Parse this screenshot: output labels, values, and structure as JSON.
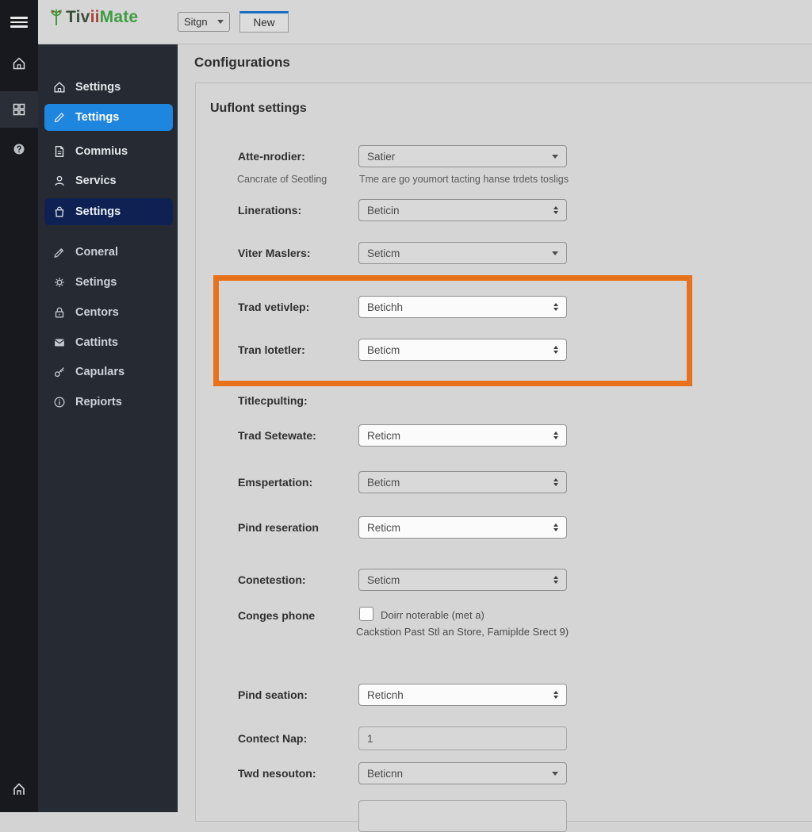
{
  "app": {
    "logo_parts": [
      {
        "text": "Tiv",
        "color": "#3c4f3c"
      },
      {
        "text": "ii",
        "color": "#a8463a"
      },
      {
        "text": "Mate",
        "color": "#3f9c3f"
      }
    ],
    "colors": {
      "sidebar_bg": "#262b33",
      "icon_strip_bg": "#17191e",
      "active_item_blue": "#1e86de",
      "active_item_navy": "#0e2152",
      "highlight_orange": "#e8721c",
      "new_button_accent": "#1a6fc4",
      "main_bg": "#d3d3d4"
    }
  },
  "topbar": {
    "sign_label": "Sitgn",
    "new_label": "New"
  },
  "icon_strip": {
    "icons": [
      "hamburger-menu",
      "home",
      "modules-grid",
      "help-circle",
      "home-bottom"
    ]
  },
  "sidebar": {
    "items": [
      {
        "label": "Settings",
        "icon": "home",
        "state": "normal"
      },
      {
        "label": "Tettings",
        "icon": "pencil",
        "state": "active-blue"
      },
      {
        "label": "Commius",
        "icon": "document",
        "state": "normal"
      },
      {
        "label": "Servics",
        "icon": "person",
        "state": "normal"
      },
      {
        "label": "Settings",
        "icon": "bag",
        "state": "active-navy"
      },
      {
        "label": "Coneral",
        "icon": "pen",
        "state": "dim"
      },
      {
        "label": "Setings",
        "icon": "gear",
        "state": "dim"
      },
      {
        "label": "Centors",
        "icon": "lock",
        "state": "dim"
      },
      {
        "label": "Cattints",
        "icon": "envelope",
        "state": "dim"
      },
      {
        "label": "Capulars",
        "icon": "key",
        "state": "dim"
      },
      {
        "label": "Repiorts",
        "icon": "info-circle",
        "state": "dim"
      }
    ]
  },
  "main": {
    "heading": "Configurations",
    "section_title": "Uuflont settings",
    "form": {
      "rows": [
        {
          "label": "Atte-nrodier:",
          "value": "Satier",
          "helper_left": "Cancrate of Seotling",
          "helper_right": "Tme are go youmort tacting hanse trdets tosligs"
        },
        {
          "label": "Linerations:",
          "value": "Beticin"
        },
        {
          "label": "Viter Maslers:",
          "value": "Seticm"
        },
        {
          "label": "Trad vetivlep:",
          "value": "Betichh"
        },
        {
          "label": "Tran lotetler:",
          "value": "Beticm"
        },
        {
          "label": "Titlecpulting:"
        },
        {
          "label": "Trad Setewate:",
          "value": "Reticm"
        },
        {
          "label": "Emspertation:",
          "value": "Beticm"
        },
        {
          "label": "Pind reseration",
          "value": "Reticm"
        },
        {
          "label": "Conetestion:",
          "value": "Seticm"
        },
        {
          "label": "Conges phone",
          "checkbox_checked": false,
          "checkbox_label": "Doirr noterable (met a)",
          "checkbox_sub": "Cackstion Past Stl an Store, Famiplde Srect 9)"
        },
        {
          "label": "Pind seation:",
          "value": "Reticnh"
        },
        {
          "label": "Contect Nap:",
          "value": "1"
        },
        {
          "label": "Twd nesouton:",
          "value": "Beticnn"
        },
        {
          "label": "",
          "value": ""
        }
      ]
    }
  }
}
